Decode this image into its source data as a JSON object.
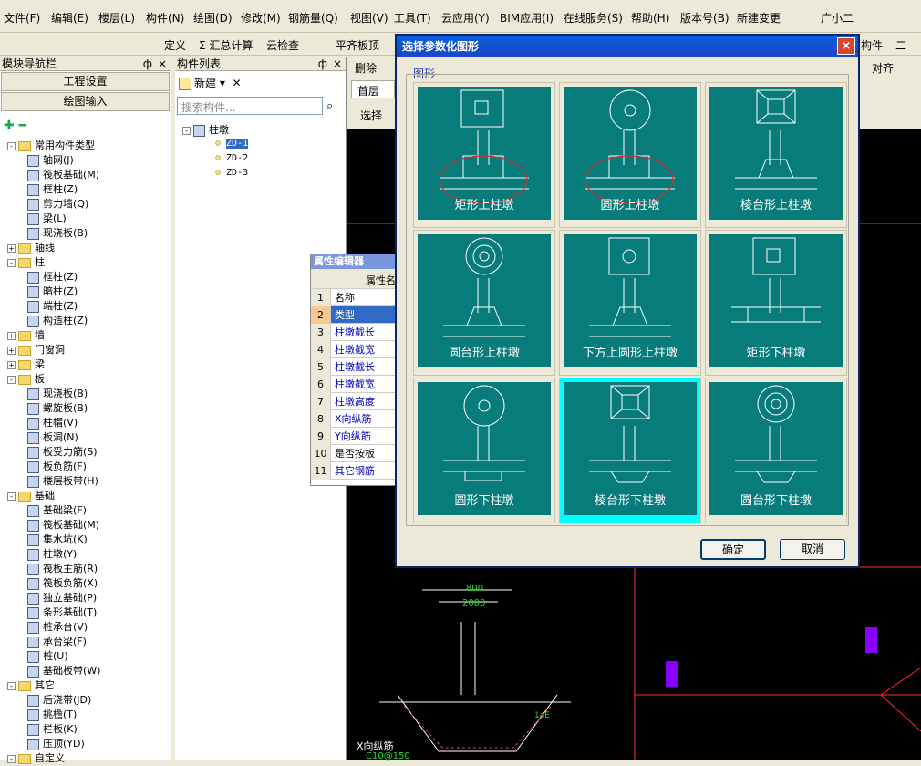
{
  "menu": {
    "items": [
      "文件(F)",
      "编辑(E)",
      "楼层(L)",
      "构件(N)",
      "绘图(D)",
      "修改(M)",
      "钢筋量(Q)",
      "视图(V)",
      "工具(T)",
      "云应用(Y)",
      "BIM应用(I)",
      "在线服务(S)",
      "帮助(H)",
      "版本号(B)",
      "新建变更",
      "广小二"
    ]
  },
  "toolbar": {
    "items": [
      "定义",
      "Σ 汇总计算",
      "云检查",
      "平齐板顶",
      "构件",
      "二"
    ]
  },
  "left_panel": {
    "title": "模块导航栏",
    "pin": "ф",
    "close": "×",
    "btn1": "工程设置",
    "btn2": "绘图输入",
    "tree": [
      {
        "label": "常用构件类型",
        "level": 0,
        "exp": "-",
        "folder": true
      },
      {
        "label": "轴网(J)",
        "level": 1
      },
      {
        "label": "筏板基础(M)",
        "level": 1
      },
      {
        "label": "框柱(Z)",
        "level": 1
      },
      {
        "label": "剪力墙(Q)",
        "level": 1
      },
      {
        "label": "梁(L)",
        "level": 1
      },
      {
        "label": "现浇板(B)",
        "level": 1
      },
      {
        "label": "轴线",
        "level": 0,
        "exp": "+",
        "folder": true
      },
      {
        "label": "柱",
        "level": 0,
        "exp": "-",
        "folder": true
      },
      {
        "label": "框柱(Z)",
        "level": 1
      },
      {
        "label": "暗柱(Z)",
        "level": 1
      },
      {
        "label": "端柱(Z)",
        "level": 1
      },
      {
        "label": "构造柱(Z)",
        "level": 1
      },
      {
        "label": "墙",
        "level": 0,
        "exp": "+",
        "folder": true
      },
      {
        "label": "门窗洞",
        "level": 0,
        "exp": "+",
        "folder": true
      },
      {
        "label": "梁",
        "level": 0,
        "exp": "+",
        "folder": true
      },
      {
        "label": "板",
        "level": 0,
        "exp": "-",
        "folder": true
      },
      {
        "label": "现浇板(B)",
        "level": 1
      },
      {
        "label": "螺旋板(B)",
        "level": 1
      },
      {
        "label": "柱帽(V)",
        "level": 1
      },
      {
        "label": "板洞(N)",
        "level": 1
      },
      {
        "label": "板受力筋(S)",
        "level": 1
      },
      {
        "label": "板负筋(F)",
        "level": 1
      },
      {
        "label": "楼层板带(H)",
        "level": 1
      },
      {
        "label": "基础",
        "level": 0,
        "exp": "-",
        "folder": true
      },
      {
        "label": "基础梁(F)",
        "level": 1
      },
      {
        "label": "筏板基础(M)",
        "level": 1
      },
      {
        "label": "集水坑(K)",
        "level": 1
      },
      {
        "label": "柱墩(Y)",
        "level": 1
      },
      {
        "label": "筏板主筋(R)",
        "level": 1
      },
      {
        "label": "筏板负筋(X)",
        "level": 1
      },
      {
        "label": "独立基础(P)",
        "level": 1
      },
      {
        "label": "条形基础(T)",
        "level": 1
      },
      {
        "label": "桩承台(V)",
        "level": 1
      },
      {
        "label": "承台梁(F)",
        "level": 1
      },
      {
        "label": "桩(U)",
        "level": 1
      },
      {
        "label": "基础板带(W)",
        "level": 1
      },
      {
        "label": "其它",
        "level": 0,
        "exp": "-",
        "folder": true
      },
      {
        "label": "后浇带(JD)",
        "level": 1
      },
      {
        "label": "挑檐(T)",
        "level": 1
      },
      {
        "label": "栏板(K)",
        "level": 1
      },
      {
        "label": "压顶(YD)",
        "level": 1
      },
      {
        "label": "自定义",
        "level": 0,
        "exp": "-",
        "folder": true
      }
    ]
  },
  "mid_panel": {
    "title": "构件列表",
    "pin": "ф",
    "close": "×",
    "new_btn": "新建",
    "search_placeholder": "搜索构件...",
    "root": "柱墩",
    "items": [
      "ZD-1",
      "ZD-2",
      "ZD-3"
    ]
  },
  "draw": {
    "delete": "删除",
    "floor": "首层",
    "select": "选择",
    "align": "对齐"
  },
  "prop": {
    "title": "属性编辑器",
    "col": "属性名",
    "rows": [
      {
        "n": "1",
        "v": "名称"
      },
      {
        "n": "2",
        "v": "类型"
      },
      {
        "n": "3",
        "v": "柱墩截长"
      },
      {
        "n": "4",
        "v": "柱墩截宽"
      },
      {
        "n": "5",
        "v": "柱墩截长"
      },
      {
        "n": "6",
        "v": "柱墩截宽"
      },
      {
        "n": "7",
        "v": "柱墩高度"
      },
      {
        "n": "8",
        "v": "X向纵筋"
      },
      {
        "n": "9",
        "v": "Y向纵筋"
      },
      {
        "n": "10",
        "v": "是否按板"
      },
      {
        "n": "11",
        "v": "其它钢筋"
      }
    ]
  },
  "dialog": {
    "title": "选择参数化图形",
    "close": "×",
    "group": "图形",
    "ok": "确定",
    "cancel": "取消",
    "tiles": [
      {
        "label": "矩形上柱墩",
        "top": "rect",
        "bottom": "rect",
        "red": true
      },
      {
        "label": "圆形上柱墩",
        "top": "circle",
        "bottom": "rect",
        "red": true
      },
      {
        "label": "棱台形上柱墩",
        "top": "frustum",
        "bottom": "trap",
        "red": false
      },
      {
        "label": "圆台形上柱墩",
        "top": "ring",
        "bottom": "trap",
        "red": false
      },
      {
        "label": "下方上圆形上柱墩",
        "top": "squarecircle",
        "bottom": "trap",
        "red": false
      },
      {
        "label": "矩形下柱墩",
        "top": "rect",
        "bottom": "slab",
        "red": false
      },
      {
        "label": "圆形下柱墩",
        "top": "circle",
        "bottom": "slabdown",
        "red": false
      },
      {
        "label": "棱台形下柱墩",
        "top": "frustum",
        "bottom": "trapdown",
        "red": false,
        "selected": true
      },
      {
        "label": "圆台形下柱墩",
        "top": "ring",
        "bottom": "trapdown",
        "red": false
      }
    ]
  },
  "cad": {
    "dim1": "800",
    "dim2": "2000",
    "rebar": "X向纵筋",
    "spec": "C10@150",
    "la": "1aE",
    "h": "600"
  }
}
